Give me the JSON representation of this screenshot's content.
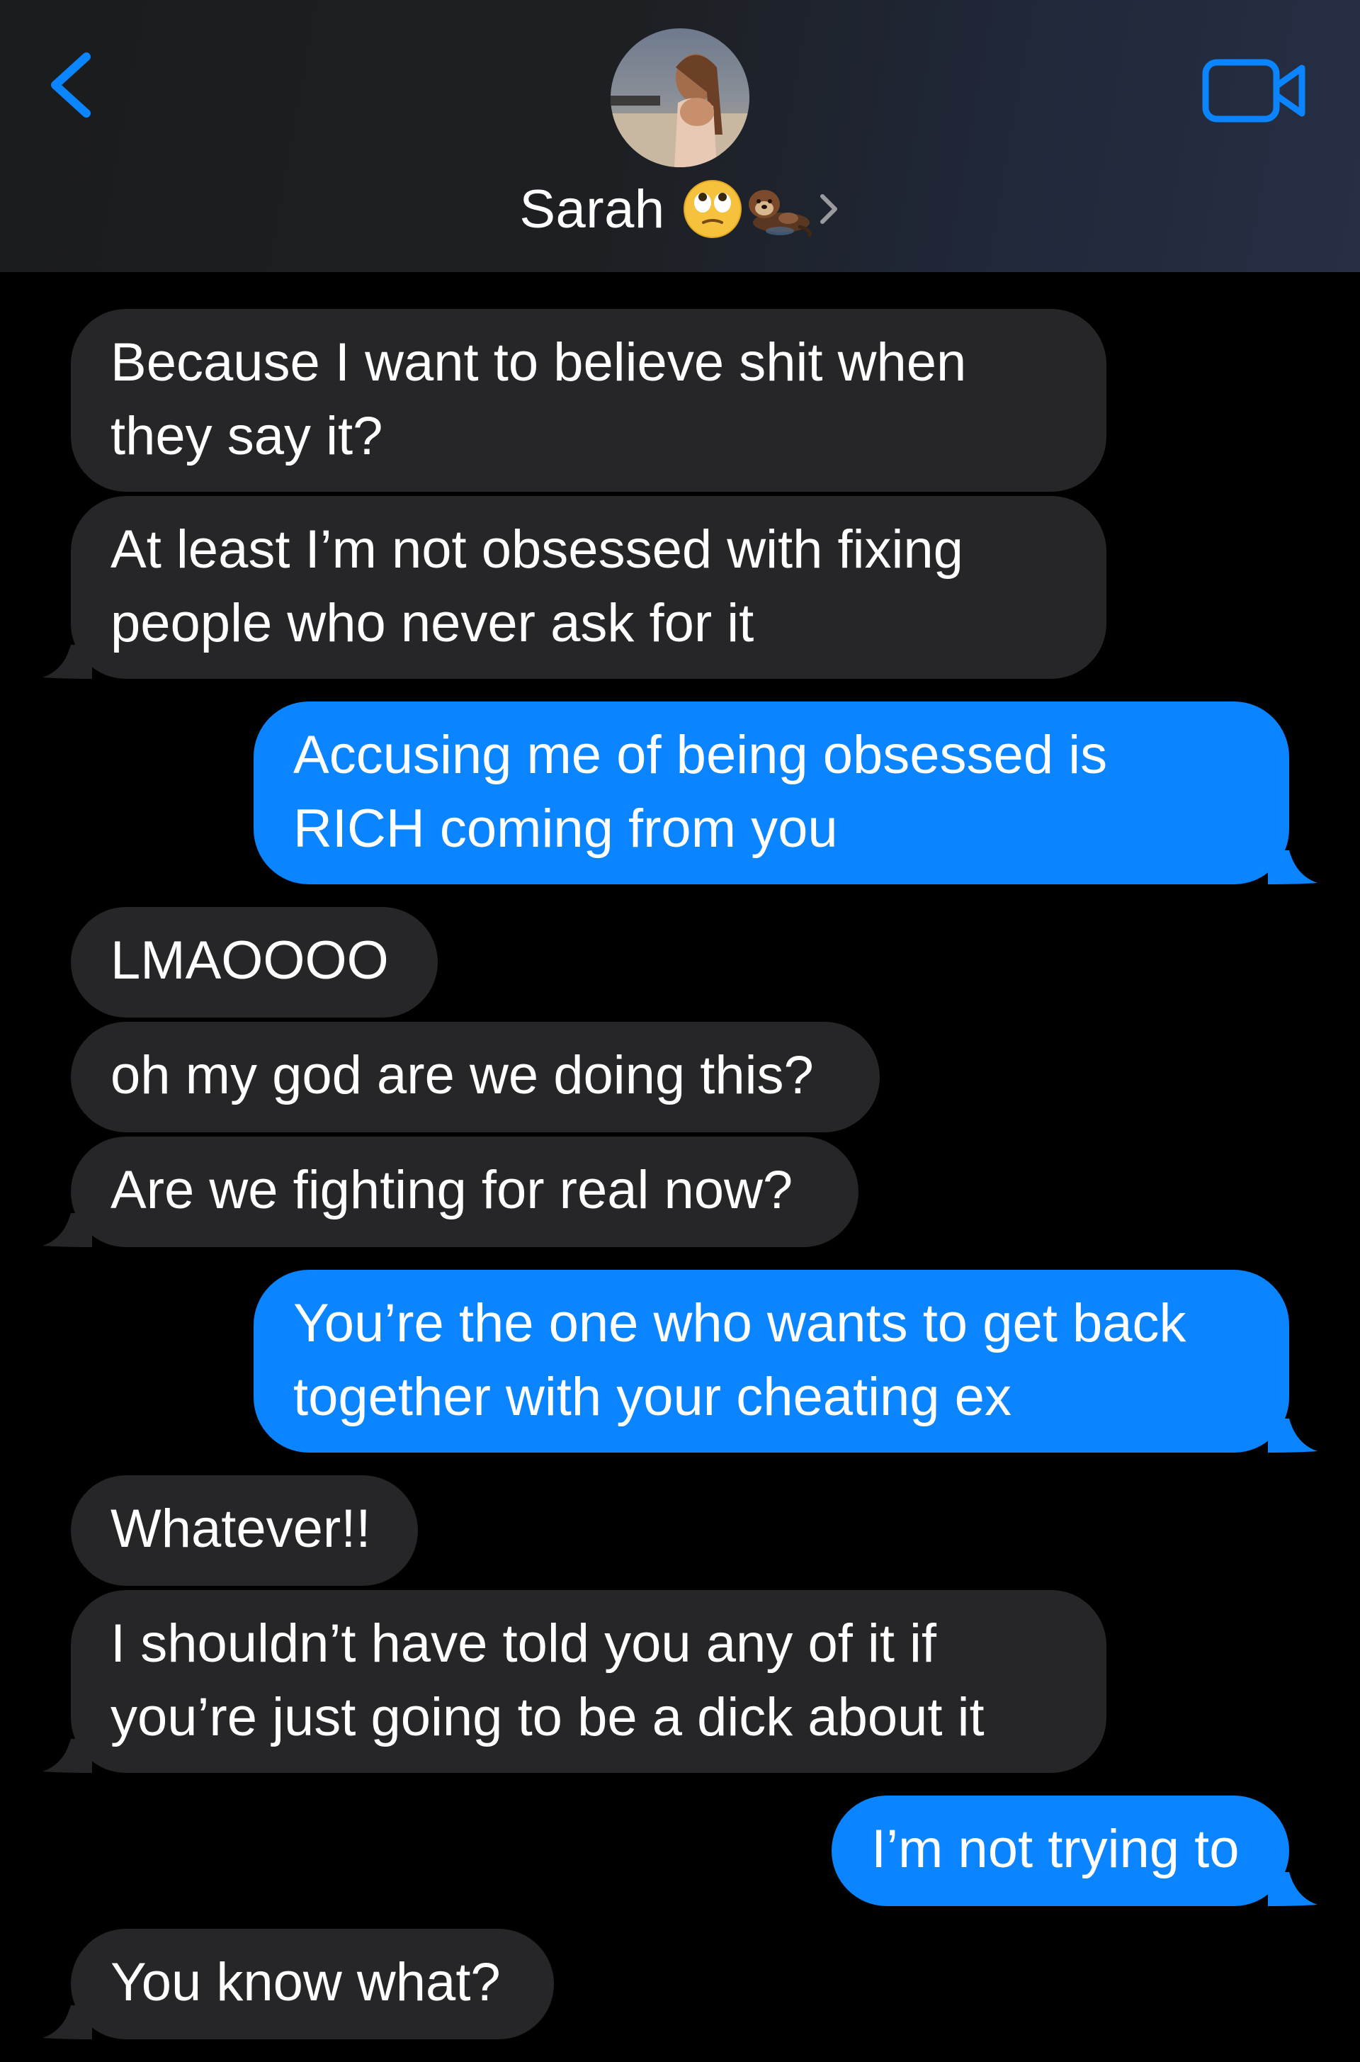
{
  "header": {
    "contact_name": "Sarah",
    "emojis": [
      "face-with-rolling-eyes-emoji",
      "otter-emoji"
    ],
    "accent_color": "#0b84ff"
  },
  "messages": [
    {
      "direction": "incoming",
      "text_lines": [
        "Because I want to believe shit when",
        "they say it?"
      ]
    },
    {
      "direction": "incoming",
      "text_lines": [
        "At least I’m not obsessed with fixing",
        "people who never ask for it"
      ]
    },
    {
      "direction": "outgoing",
      "text_lines": [
        "Accusing me of being obsessed is",
        "RICH coming from you"
      ]
    },
    {
      "direction": "incoming",
      "text_lines": [
        "LMAOOOO"
      ]
    },
    {
      "direction": "incoming",
      "text_lines": [
        "oh my god are we doing this?"
      ]
    },
    {
      "direction": "incoming",
      "text_lines": [
        "Are we fighting for real now?"
      ]
    },
    {
      "direction": "outgoing",
      "text_lines": [
        "You’re the one who wants to get back",
        "together with your cheating ex"
      ]
    },
    {
      "direction": "incoming",
      "text_lines": [
        "Whatever!!"
      ]
    },
    {
      "direction": "incoming",
      "text_lines": [
        "I shouldn’t have told you any of it if",
        "you’re just going to be a dick about it"
      ]
    },
    {
      "direction": "outgoing",
      "text_lines": [
        "I’m not trying to"
      ]
    },
    {
      "direction": "incoming",
      "text_lines": [
        "You know what?"
      ]
    }
  ],
  "colors": {
    "incoming_bubble": "#262628",
    "outgoing_bubble": "#0b84ff",
    "background": "#000000"
  }
}
